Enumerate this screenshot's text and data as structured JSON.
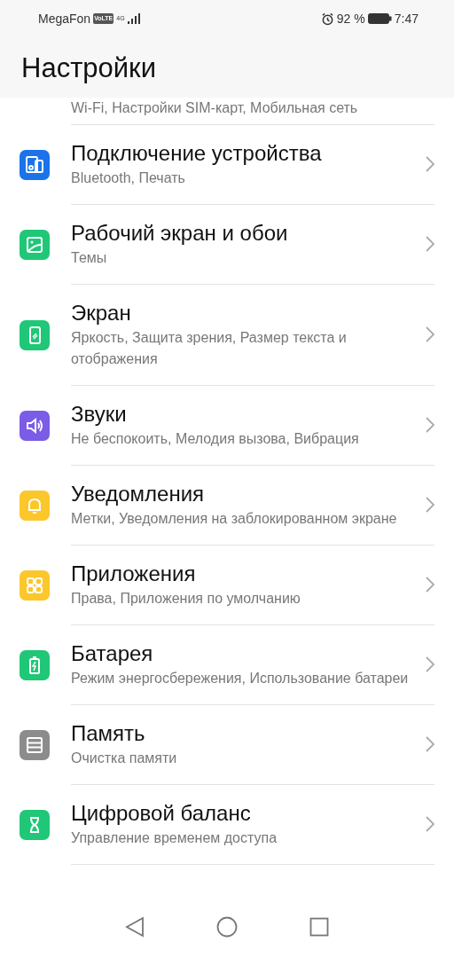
{
  "status_bar": {
    "carrier": "MegaFon",
    "volte": "VoLTE",
    "network": "4G",
    "battery_percent": "92 %",
    "time": "7:47"
  },
  "header": {
    "title": "Настройки"
  },
  "partial_item": {
    "subtitle": "Wi-Fi, Настройки SIM-карт, Мобильная сеть"
  },
  "items": [
    {
      "kind": "devices",
      "color": "#1a73e8",
      "title": "Подключение устройства",
      "subtitle": "Bluetooth, Печать"
    },
    {
      "kind": "wallpaper",
      "color": "#1fc777",
      "title": "Рабочий экран и обои",
      "subtitle": "Темы"
    },
    {
      "kind": "display",
      "color": "#1fc777",
      "title": "Экран",
      "subtitle": "Яркость, Защита зрения, Размер текста и отображения"
    },
    {
      "kind": "sound",
      "color": "#7b5ce6",
      "title": "Звуки",
      "subtitle": "Не беспокоить, Мелодия вызова, Вибрация"
    },
    {
      "kind": "bell",
      "color": "#fbc72b",
      "title": "Уведомления",
      "subtitle": "Метки, Уведомления на заблокированном экране"
    },
    {
      "kind": "apps",
      "color": "#fbc72b",
      "title": "Приложения",
      "subtitle": "Права, Приложения по умолчанию"
    },
    {
      "kind": "battery",
      "color": "#1fc777",
      "title": "Батарея",
      "subtitle": "Режим энергосбережения, Использование батареи"
    },
    {
      "kind": "storage",
      "color": "#8c8c8c",
      "title": "Память",
      "subtitle": "Очистка памяти"
    },
    {
      "kind": "hourglass",
      "color": "#1fc777",
      "title": "Цифровой баланс",
      "subtitle": "Управление временем доступа"
    }
  ]
}
